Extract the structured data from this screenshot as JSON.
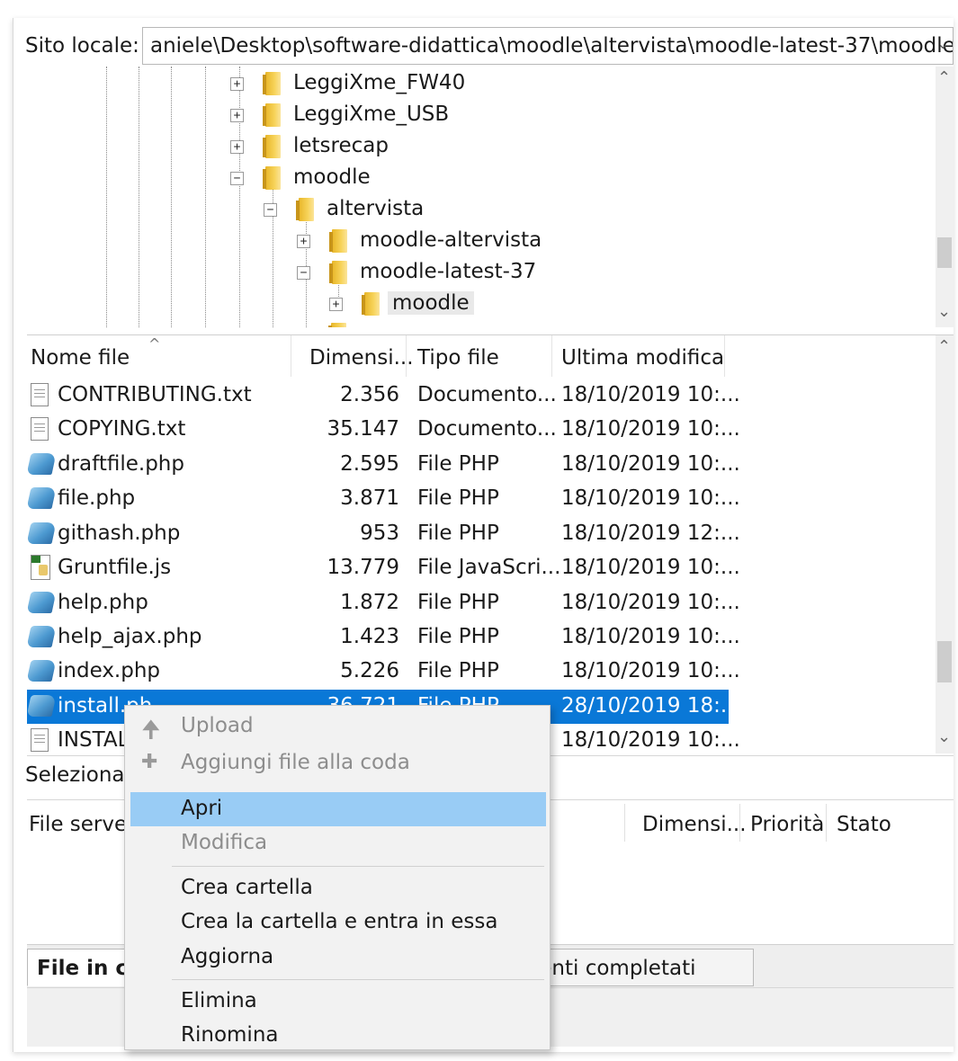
{
  "site_bar": {
    "label": "Sito locale:",
    "path": "aniele\\Desktop\\software-didattica\\moodle\\altervista\\moodle-latest-37\\moodle\\"
  },
  "tree": {
    "nodes": [
      {
        "label": "LeggiXme_FW40",
        "expander": "+"
      },
      {
        "label": "LeggiXme_USB",
        "expander": "+"
      },
      {
        "label": "letsrecap",
        "expander": "+"
      },
      {
        "label": "moodle",
        "expander": "−"
      },
      {
        "label": "altervista",
        "expander": "−"
      },
      {
        "label": "moodle-altervista",
        "expander": "+"
      },
      {
        "label": "moodle-latest-37",
        "expander": "−"
      },
      {
        "label": "moodle",
        "expander": "+"
      }
    ]
  },
  "file_list": {
    "headers": [
      "Nome file",
      "Dimensi...",
      "Tipo file",
      "Ultima modifica"
    ],
    "rows": [
      {
        "name": "CONTRIBUTING.txt",
        "size": "2.356",
        "type": "Documento...",
        "modified": "18/10/2019 10:...",
        "icon": "text-file-icon"
      },
      {
        "name": "COPYING.txt",
        "size": "35.147",
        "type": "Documento...",
        "modified": "18/10/2019 10:...",
        "icon": "text-file-icon"
      },
      {
        "name": "draftfile.php",
        "size": "2.595",
        "type": "File PHP",
        "modified": "18/10/2019 10:...",
        "icon": "php-file-icon"
      },
      {
        "name": "file.php",
        "size": "3.871",
        "type": "File PHP",
        "modified": "18/10/2019 10:...",
        "icon": "php-file-icon"
      },
      {
        "name": "githash.php",
        "size": "953",
        "type": "File PHP",
        "modified": "18/10/2019 12:...",
        "icon": "php-file-icon"
      },
      {
        "name": "Gruntfile.js",
        "size": "13.779",
        "type": "File JavaScri...",
        "modified": "18/10/2019 10:...",
        "icon": "js-file-icon"
      },
      {
        "name": "help.php",
        "size": "1.872",
        "type": "File PHP",
        "modified": "18/10/2019 10:...",
        "icon": "php-file-icon"
      },
      {
        "name": "help_ajax.php",
        "size": "1.423",
        "type": "File PHP",
        "modified": "18/10/2019 10:...",
        "icon": "php-file-icon"
      },
      {
        "name": "index.php",
        "size": "5.226",
        "type": "File PHP",
        "modified": "18/10/2019 10:...",
        "icon": "php-file-icon"
      },
      {
        "name": "install.ph",
        "size": "36.721",
        "type": "File PHP",
        "modified": "28/10/2019 18:...",
        "icon": "php-file-icon",
        "selected": true
      },
      {
        "name": "INSTAL",
        "size": "",
        "type": "",
        "modified": "18/10/2019 10:...",
        "icon": "text-file-icon"
      }
    ]
  },
  "status_line": {
    "text": "Selezionat"
  },
  "queue": {
    "headers": [
      "File server",
      "Dimensi...",
      "Priorità",
      "Stato"
    ]
  },
  "tabs": {
    "active": "File in co",
    "completed": "rimenti completati"
  },
  "context_menu": {
    "items": [
      {
        "label": "Upload",
        "disabled": true,
        "icon": "upload-arrow-icon"
      },
      {
        "label": "Aggiungi file alla coda",
        "disabled": true,
        "icon": "add-to-queue-icon"
      },
      {
        "label": "Apri",
        "highlight": true
      },
      {
        "label": "Modifica",
        "disabled": true
      },
      {
        "label": "Crea cartella"
      },
      {
        "label": "Crea la cartella e entra in essa"
      },
      {
        "label": "Aggiorna"
      },
      {
        "label": "Elimina"
      },
      {
        "label": "Rinomina"
      }
    ]
  },
  "colors": {
    "selection": "#0a78d7",
    "menu_highlight": "#99ccf5",
    "menu_background": "#f2f2f2",
    "disabled_text": "#8d8d8d"
  }
}
